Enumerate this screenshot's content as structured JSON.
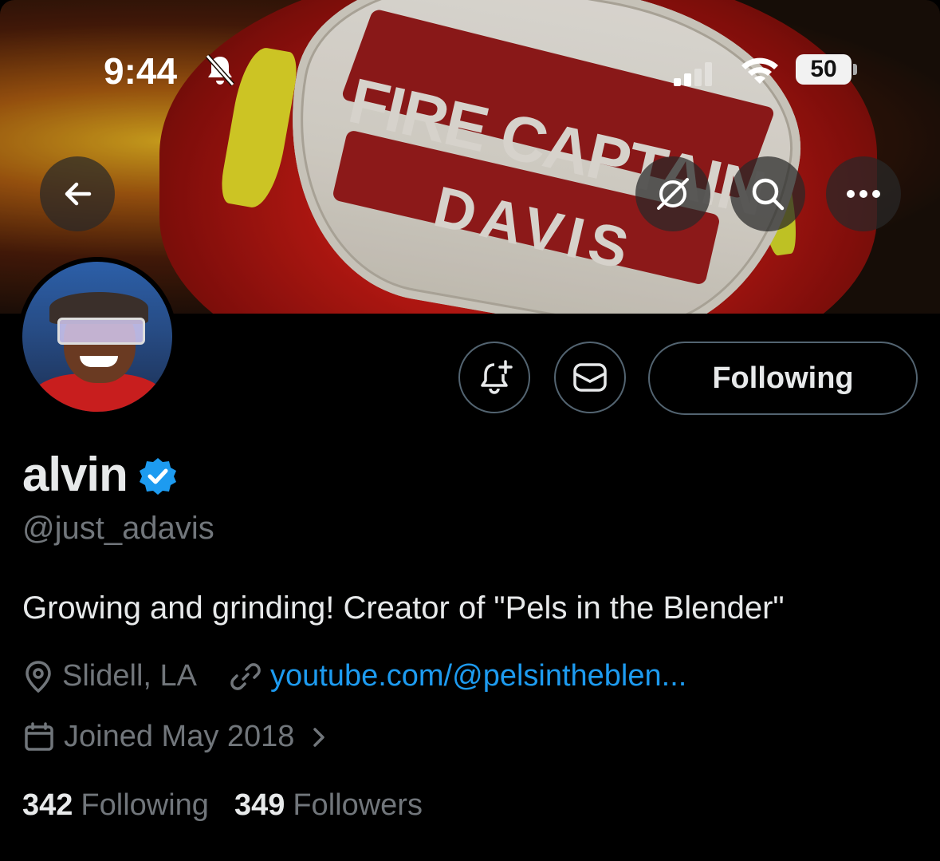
{
  "status_bar": {
    "time": "9:44",
    "battery": "50"
  },
  "banner": {
    "line1": "FIRE CAPTAIN",
    "line2": "DAVIS"
  },
  "header_actions": {
    "back_icon": "arrow-left-icon",
    "grok_icon": "grok-icon",
    "search_icon": "search-icon",
    "more_icon": "more-horizontal-icon"
  },
  "profile": {
    "display_name": "alvin",
    "verified": true,
    "handle": "@just_adavis",
    "bio": "Growing and grinding! Creator of \"Pels in the Blender\"",
    "location": "Slidell, LA",
    "website": "youtube.com/@pelsintheblen...",
    "joined": "Joined May 2018",
    "following_count": "342",
    "following_label": "Following",
    "followers_count": "349",
    "followers_label": "Followers"
  },
  "buttons": {
    "following_label": "Following"
  },
  "colors": {
    "background": "#000000",
    "text_primary": "#e7e9ea",
    "text_secondary": "#71767b",
    "link": "#1d9bf0",
    "verified": "#1d9bf0",
    "button_border": "#536471"
  }
}
